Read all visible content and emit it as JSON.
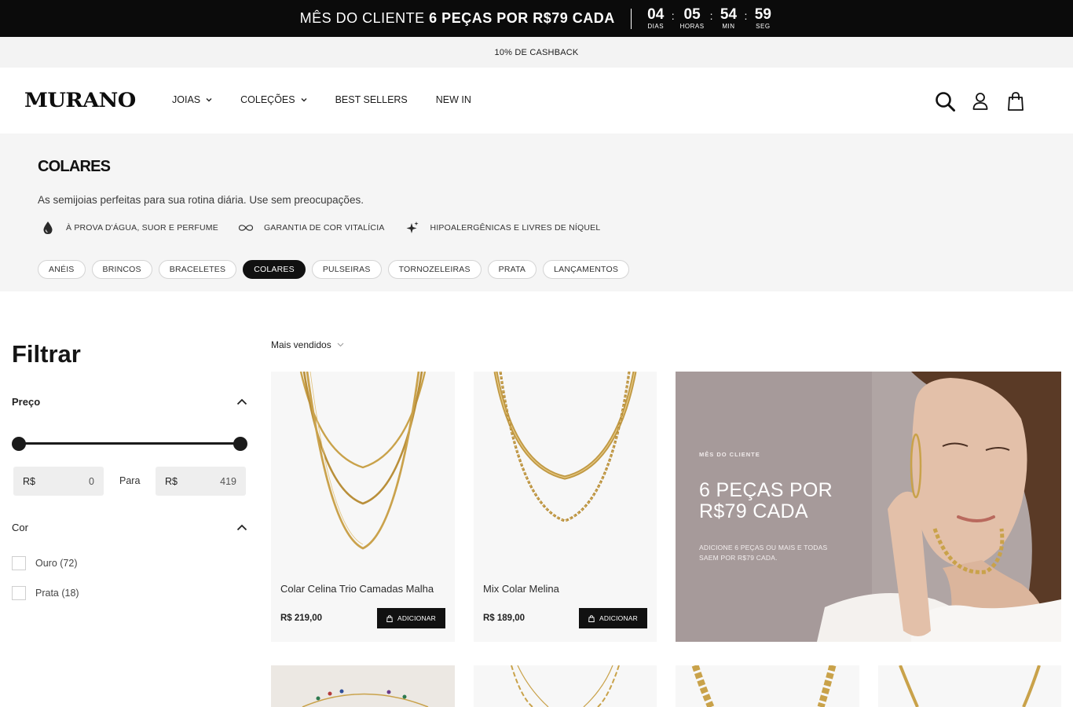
{
  "promo": {
    "text_prefix": "MÊS DO CLIENTE",
    "text_bold": "6 PEÇAS POR R$79 CADA",
    "countdown": [
      {
        "value": "04",
        "label": "DIAS"
      },
      {
        "value": "05",
        "label": "HORAS"
      },
      {
        "value": "54",
        "label": "MIN"
      },
      {
        "value": "59",
        "label": "SEG"
      }
    ]
  },
  "cashback": "10% DE CASHBACK",
  "header": {
    "logo": "MURANO",
    "nav": [
      {
        "label": "JOIAS",
        "has_dropdown": true
      },
      {
        "label": "COLEÇÕES",
        "has_dropdown": true
      },
      {
        "label": "BEST SELLERS",
        "has_dropdown": false
      },
      {
        "label": "NEW IN",
        "has_dropdown": false
      }
    ],
    "icons": [
      "search-icon",
      "account-icon",
      "bag-icon"
    ]
  },
  "category": {
    "title": "COLARES",
    "description": "As semijoias perfeitas para sua rotina diária. Use sem preocupações.",
    "features": [
      {
        "icon": "water-drop-icon",
        "label": "À PROVA D'ÁGUA, SUOR E PERFUME"
      },
      {
        "icon": "infinity-icon",
        "label": "GARANTIA DE COR VITALÍCIA"
      },
      {
        "icon": "sparkle-icon",
        "label": "HIPOALERGÊNICAS E LIVRES DE NÍQUEL"
      }
    ],
    "pills": [
      "ANÉIS",
      "BRINCOS",
      "BRACELETES",
      "COLARES",
      "PULSEIRAS",
      "TORNOZELEIRAS",
      "PRATA",
      "LANÇAMENTOS"
    ],
    "active_pill": "COLARES"
  },
  "filter": {
    "title": "Filtrar",
    "price": {
      "label": "Preço",
      "currency": "R$",
      "min": "0",
      "max": "419",
      "separator": "Para"
    },
    "color": {
      "label": "Cor",
      "options": [
        {
          "label": "Ouro (72)",
          "checked": false
        },
        {
          "label": "Prata (18)",
          "checked": false
        }
      ]
    }
  },
  "sort": {
    "selected": "Mais vendidos"
  },
  "products": [
    {
      "name": "Colar Celina Trio Camadas Malha",
      "price": "R$ 219,00",
      "button": "ADICIONAR"
    },
    {
      "name": "Mix Colar Melina",
      "price": "R$ 189,00",
      "button": "ADICIONAR"
    }
  ],
  "banner": {
    "eyebrow": "MÊS DO CLIENTE",
    "title": "6 PEÇAS POR R$79 CADA",
    "text": "ADICIONE 6 PEÇAS OU MAIS E TODAS SAEM POR R$79 CADA."
  },
  "colors": {
    "promo_bg": "#0b0b0b",
    "hero_bg": "#f5f5f5",
    "accent": "#111111",
    "gold": "#c9a24a",
    "banner_bg": "#a69a9a"
  }
}
